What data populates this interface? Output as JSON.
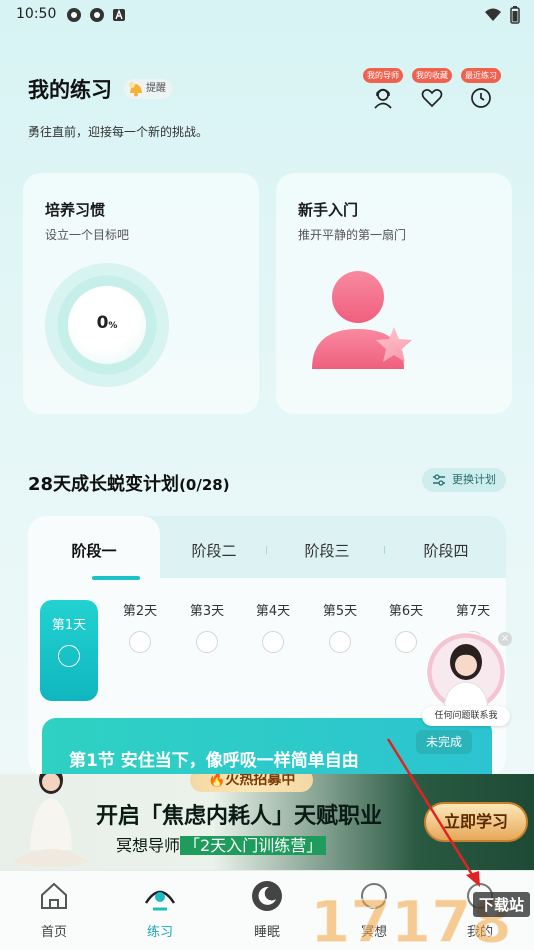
{
  "status_bar": {
    "time": "10:50"
  },
  "header": {
    "title": "我的练习",
    "remind_label": "提醒",
    "subtitle": "勇往直前，迎接每一个新的挑战。",
    "actions": [
      {
        "badge": "我的导师",
        "icon": "headset-icon"
      },
      {
        "badge": "我的收藏",
        "icon": "heart-icon"
      },
      {
        "badge": "最近练习",
        "icon": "clock-icon"
      }
    ]
  },
  "cards": {
    "habit": {
      "title": "培养习惯",
      "subtitle": "设立一个目标吧",
      "progress_value": "0",
      "progress_unit": "%"
    },
    "beginner": {
      "title": "新手入门",
      "subtitle": "推开平静的第一扇门"
    }
  },
  "plan": {
    "title": "28天成长蜕变计划",
    "count": "(0/28)",
    "change_label": "更换计划",
    "stages": [
      "阶段一",
      "阶段二",
      "阶段三",
      "阶段四"
    ],
    "active_stage": 0,
    "days": [
      "第1天",
      "第2天",
      "第3天",
      "第4天",
      "第5天",
      "第6天",
      "第7天"
    ],
    "active_day": 0,
    "lesson": {
      "title": "第1节 安住当下，像呼吸一样简单自由",
      "status": "未完成"
    }
  },
  "service": {
    "label": "任何问题联系我",
    "close": "×"
  },
  "ad": {
    "hot_label": "🔥火热招募中",
    "headline": "开启「焦虑内耗人」天赋职业",
    "sub_prefix": "冥想导师",
    "sub_highlight": "「2天入门训练营」",
    "cta": "立即学习"
  },
  "nav": {
    "items": [
      {
        "label": "首页",
        "icon": "home-icon"
      },
      {
        "label": "练习",
        "icon": "meditation-icon"
      },
      {
        "label": "睡眠",
        "icon": "moon-icon"
      },
      {
        "label": "冥想",
        "icon": "meditate-icon"
      },
      {
        "label": "我的",
        "icon": "profile-icon"
      }
    ],
    "active": 1
  },
  "watermark": {
    "text": "17178",
    "sub": "下载站"
  },
  "colors": {
    "accent": "#1cc2c8",
    "badge": "#f0624f",
    "card_pink": "#f06a86"
  }
}
